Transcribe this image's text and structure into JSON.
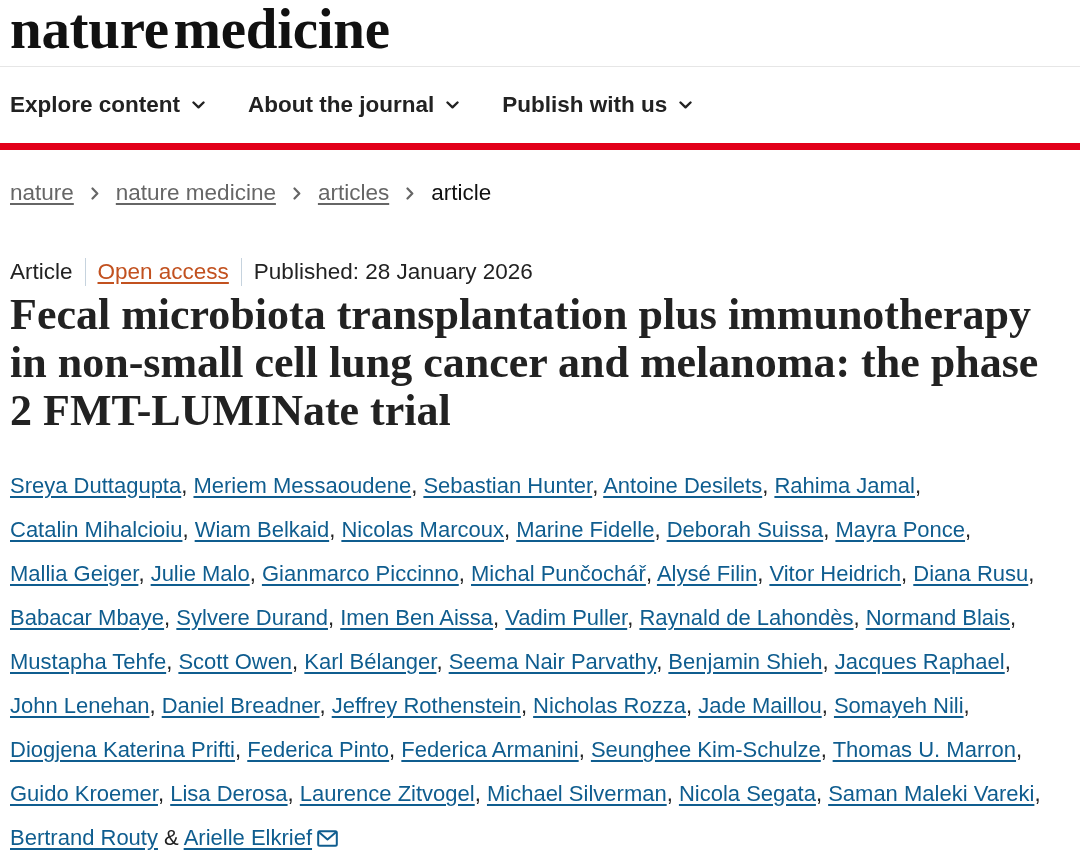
{
  "site": {
    "logo": "nature medicine"
  },
  "nav": [
    {
      "label": "Explore content"
    },
    {
      "label": "About the journal"
    },
    {
      "label": "Publish with us"
    }
  ],
  "breadcrumbs": [
    {
      "label": "nature",
      "current": false
    },
    {
      "label": "nature medicine",
      "current": false
    },
    {
      "label": "articles",
      "current": false
    },
    {
      "label": "article",
      "current": true
    }
  ],
  "article": {
    "type": "Article",
    "access": "Open access",
    "published": "Published: 28 January 2026",
    "title": "Fecal microbiota transplantation plus immunotherapy in non-small cell lung cancer and melanoma: the phase 2 FMT-LUMINate trial",
    "authors": {
      "separator": ",",
      "last_separator": "&",
      "list": [
        {
          "name": "Sreya Duttagupta",
          "corresponding": false
        },
        {
          "name": "Meriem Messaoudene",
          "corresponding": false
        },
        {
          "name": "Sebastian Hunter",
          "corresponding": false
        },
        {
          "name": "Antoine Desilets",
          "corresponding": false
        },
        {
          "name": "Rahima Jamal",
          "corresponding": false
        },
        {
          "name": "Catalin Mihalcioiu",
          "corresponding": false
        },
        {
          "name": "Wiam Belkaid",
          "corresponding": false
        },
        {
          "name": "Nicolas Marcoux",
          "corresponding": false
        },
        {
          "name": "Marine Fidelle",
          "corresponding": false
        },
        {
          "name": "Deborah Suissa",
          "corresponding": false
        },
        {
          "name": "Mayra Ponce",
          "corresponding": false
        },
        {
          "name": "Mallia Geiger",
          "corresponding": false
        },
        {
          "name": "Julie Malo",
          "corresponding": false
        },
        {
          "name": "Gianmarco Piccinno",
          "corresponding": false
        },
        {
          "name": "Michal Punčochář",
          "corresponding": false
        },
        {
          "name": "Alysé Filin",
          "corresponding": false
        },
        {
          "name": "Vitor Heidrich",
          "corresponding": false
        },
        {
          "name": "Diana Rusu",
          "corresponding": false
        },
        {
          "name": "Babacar Mbaye",
          "corresponding": false
        },
        {
          "name": "Sylvere Durand",
          "corresponding": false
        },
        {
          "name": "Imen Ben Aissa",
          "corresponding": false
        },
        {
          "name": "Vadim Puller",
          "corresponding": false
        },
        {
          "name": "Raynald de Lahondès",
          "corresponding": false
        },
        {
          "name": "Normand Blais",
          "corresponding": false
        },
        {
          "name": "Mustapha Tehfe",
          "corresponding": false
        },
        {
          "name": "Scott Owen",
          "corresponding": false
        },
        {
          "name": "Karl Bélanger",
          "corresponding": false
        },
        {
          "name": "Seema Nair Parvathy",
          "corresponding": false
        },
        {
          "name": "Benjamin Shieh",
          "corresponding": false
        },
        {
          "name": "Jacques Raphael",
          "corresponding": false
        },
        {
          "name": "John Lenehan",
          "corresponding": false
        },
        {
          "name": "Daniel Breadner",
          "corresponding": false
        },
        {
          "name": "Jeffrey Rothenstein",
          "corresponding": false
        },
        {
          "name": "Nicholas Rozza",
          "corresponding": false
        },
        {
          "name": "Jade Maillou",
          "corresponding": false
        },
        {
          "name": "Somayeh Nili",
          "corresponding": false
        },
        {
          "name": "Diogjena Katerina Prifti",
          "corresponding": false
        },
        {
          "name": "Federica Pinto",
          "corresponding": false
        },
        {
          "name": "Federica Armanini",
          "corresponding": false
        },
        {
          "name": "Seunghee Kim-Schulze",
          "corresponding": false
        },
        {
          "name": "Thomas U. Marron",
          "corresponding": false
        },
        {
          "name": "Guido Kroemer",
          "corresponding": false
        },
        {
          "name": "Lisa Derosa",
          "corresponding": false
        },
        {
          "name": "Laurence Zitvogel",
          "corresponding": false
        },
        {
          "name": "Michael Silverman",
          "corresponding": false
        },
        {
          "name": "Nicola Segata",
          "corresponding": false
        },
        {
          "name": "Saman Maleki Vareki",
          "corresponding": false
        },
        {
          "name": "Bertrand Routy",
          "corresponding": false
        },
        {
          "name": "Arielle Elkrief",
          "corresponding": true
        }
      ]
    }
  }
}
